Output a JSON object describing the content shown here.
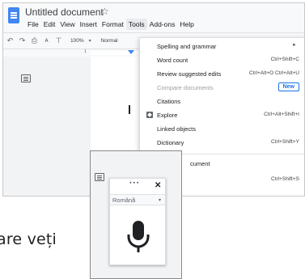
{
  "document": {
    "title": "Untitled document",
    "star": "☆",
    "menus": [
      "File",
      "Edit",
      "View",
      "Insert",
      "Format",
      "Tools",
      "Add-ons",
      "Help"
    ],
    "active_menu": "Tools",
    "toolbar": {
      "zoom": "100%",
      "style": "Normal",
      "icons": [
        "undo-icon",
        "redo-icon",
        "print-icon",
        "spellcheck-icon",
        "paint-format-icon"
      ]
    },
    "ruler_number": "1"
  },
  "tools_menu": {
    "items": [
      {
        "label": "Spelling and grammar",
        "shortcut": "",
        "submenu": true
      },
      {
        "label": "Word count",
        "shortcut": "Ctrl+Shift+C"
      },
      {
        "label": "Review suggested edits",
        "shortcut": "Ctrl+Alt+O Ctrl+Alt+U"
      },
      {
        "label": "Compare documents",
        "badge": "New",
        "disabled": true
      },
      {
        "label": "Citations",
        "shortcut": ""
      },
      {
        "label": "Explore",
        "shortcut": "Ctrl+Alt+Shift+I",
        "icon": "explore-icon"
      },
      {
        "label": "Linked objects",
        "shortcut": ""
      },
      {
        "label": "Dictionary",
        "shortcut": "Ctrl+Shift+Y"
      },
      {
        "label": "cument",
        "shortcut": ""
      },
      {
        "label": "",
        "shortcut": "Ctrl+Shift+S"
      }
    ]
  },
  "voice_typing": {
    "dots": "···",
    "close": "✕",
    "language": "Română",
    "caret": "▾"
  },
  "background_text": "are veți",
  "colors": {
    "accent": "#4285f4",
    "link_blue": "#1a73e8",
    "menu_bg": "#ffffff"
  }
}
